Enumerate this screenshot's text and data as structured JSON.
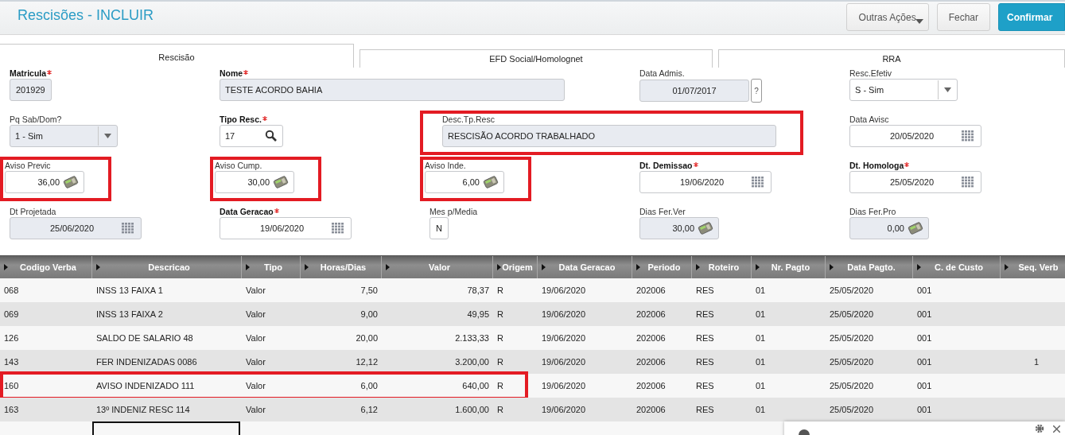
{
  "header": {
    "title": "Rescisões - INCLUIR",
    "buttons": [
      {
        "label": "Outras Ações",
        "kind": "menu"
      },
      {
        "label": "Fechar",
        "kind": "plain"
      },
      {
        "label": "Confirmar",
        "kind": "primary"
      }
    ]
  },
  "tabs": [
    {
      "label": "Rescisão",
      "selected": true
    },
    {
      "label": "EFD Social/Homolognet",
      "selected": false
    },
    {
      "label": "RRA",
      "selected": false
    }
  ],
  "form_rows": [
    [
      {
        "label": "Matricula",
        "required": true,
        "value": "201929",
        "kind": "short",
        "readonly": true,
        "highlighted": false
      },
      {
        "label": "Nome",
        "required": true,
        "value": "TESTE ACORDO BAHIA",
        "kind": "wide",
        "readonly": true,
        "highlighted": false
      },
      {
        "label": "Data Admis.",
        "required": false,
        "value": "01/07/2017",
        "kind": "help",
        "help": "?",
        "readonly": true,
        "highlighted": false
      },
      {
        "label": "Resc.Efetiv",
        "required": false,
        "value": "S - Sim",
        "kind": "select",
        "readonly": false,
        "highlighted": false
      }
    ],
    [
      {
        "label": "Pq Sab/Dom?",
        "required": false,
        "value": "1 - Sim",
        "kind": "select",
        "readonly": true,
        "highlighted": false
      },
      {
        "label": "Tipo Resc.",
        "required": true,
        "value": "17",
        "kind": "lookup",
        "readonly": false,
        "highlighted": false
      },
      {
        "label": "Desc.Tp.Resc",
        "required": false,
        "value": "RESCISÃO ACORDO TRABALHADO",
        "kind": "wide",
        "readonly": true,
        "highlighted": true
      },
      {
        "label": "Data Avisc",
        "required": false,
        "value": "20/05/2020",
        "kind": "date",
        "readonly": false,
        "highlighted": false
      }
    ],
    [
      {
        "label": "Aviso Previc",
        "required": false,
        "value": "36,00",
        "kind": "money",
        "readonly": false,
        "highlighted": true
      },
      {
        "label": "Aviso Cump.",
        "required": false,
        "value": "30,00",
        "kind": "money",
        "readonly": false,
        "highlighted": true
      },
      {
        "label": "Aviso Inde.",
        "required": false,
        "value": "6,00",
        "kind": "money",
        "readonly": false,
        "highlighted": true
      },
      {
        "label": "Dt. Demissao",
        "required": true,
        "value": "19/06/2020",
        "kind": "date",
        "readonly": false,
        "highlighted": false
      },
      {
        "label": "Dt. Homologa",
        "required": true,
        "value": "25/05/2020",
        "kind": "date",
        "readonly": false,
        "highlighted": false
      }
    ],
    [
      {
        "label": "Dt Projetada",
        "required": false,
        "value": "25/06/2020",
        "kind": "date",
        "readonly": true,
        "highlighted": false
      },
      {
        "label": "Data Geracao",
        "required": true,
        "value": "19/06/2020",
        "kind": "date",
        "readonly": false,
        "highlighted": false
      },
      {
        "label": "Mes p/Media",
        "required": false,
        "value": "N",
        "kind": "short",
        "readonly": false,
        "highlighted": false
      },
      {
        "label": "Dias Fer.Ver",
        "required": false,
        "value": "30,00",
        "kind": "money",
        "readonly": true,
        "highlighted": false
      },
      {
        "label": "Dias Fer.Pro",
        "required": false,
        "value": "0,00",
        "kind": "money",
        "readonly": true,
        "highlighted": false
      }
    ]
  ],
  "table": {
    "columns": [
      "Codigo Verba",
      "Descricao",
      "Tipo",
      "Horas/Dias",
      "Valor",
      "Origem",
      "Data Geracao",
      "Periodo",
      "Roteiro",
      "Nr. Pagto",
      "Data Pagto.",
      "C. de Custo",
      "Seq. Verb"
    ],
    "rows": [
      {
        "cells": [
          "068",
          "INSS 13 FAIXA 1",
          "Valor",
          "7,50",
          "78,37",
          "R",
          "19/06/2020",
          "202006",
          "RES",
          "01",
          "25/05/2020",
          "001",
          ""
        ],
        "highlighted": false
      },
      {
        "cells": [
          "069",
          "INSS 13 FAIXA 2",
          "Valor",
          "9,00",
          "49,95",
          "R",
          "19/06/2020",
          "202006",
          "RES",
          "01",
          "25/05/2020",
          "001",
          ""
        ],
        "highlighted": false
      },
      {
        "cells": [
          "126",
          "SALDO DE SALARIO 48",
          "Valor",
          "20,00",
          "2.133,33",
          "R",
          "19/06/2020",
          "202006",
          "RES",
          "01",
          "25/05/2020",
          "001",
          ""
        ],
        "highlighted": false
      },
      {
        "cells": [
          "143",
          "FER INDENIZADAS 0086",
          "Valor",
          "12,12",
          "3.200,00",
          "R",
          "19/06/2020",
          "202006",
          "RES",
          "01",
          "25/05/2020",
          "001",
          "1"
        ],
        "highlighted": false
      },
      {
        "cells": [
          "160",
          "AVISO INDENIZADO 111",
          "Valor",
          "6,00",
          "640,00",
          "R",
          "19/06/2020",
          "202006",
          "RES",
          "01",
          "25/05/2020",
          "001",
          ""
        ],
        "highlighted": true
      },
      {
        "cells": [
          "163",
          "13º INDENIZ RESC 114",
          "Valor",
          "6,12",
          "1.600,00",
          "R",
          "19/06/2020",
          "202006",
          "RES",
          "01",
          "25/05/2020",
          "001",
          ""
        ],
        "highlighted": false
      }
    ]
  },
  "notification": {
    "kind": "toast"
  }
}
